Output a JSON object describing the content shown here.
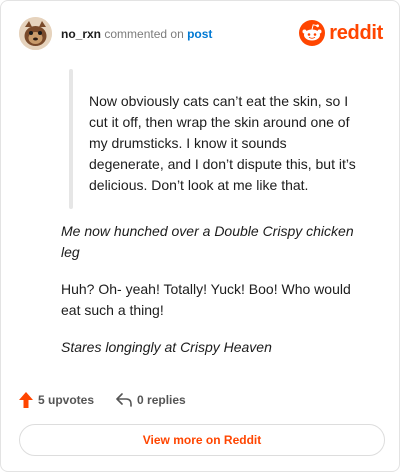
{
  "header": {
    "username": "no_rxn",
    "commented_text": "commented on",
    "post_link": "post",
    "brand": "reddit"
  },
  "comment": {
    "quote": "Now obviously cats can’t eat the skin, so I cut it off, then wrap the skin around one of my drumsticks. I know it sounds degenerate, and I don’t dispute this, but it’s delicious. Don’t look at me like that.",
    "p1": "Me now hunched over a Double Crispy chicken leg",
    "p2": "Huh? Oh- yeah! Totally! Yuck! Boo! Who would eat such a thing!",
    "p3": "Stares longingly at Crispy Heaven"
  },
  "footer": {
    "upvotes": "5 upvotes",
    "replies": "0 replies"
  },
  "actions": {
    "view_more": "View more on Reddit"
  },
  "colors": {
    "brand": "#ff4500",
    "link": "#0079d3"
  },
  "icons": {
    "avatar": "user-avatar",
    "logo": "reddit-snoo-icon",
    "upvote": "upvote-arrow-icon",
    "reply": "reply-arrow-icon"
  }
}
